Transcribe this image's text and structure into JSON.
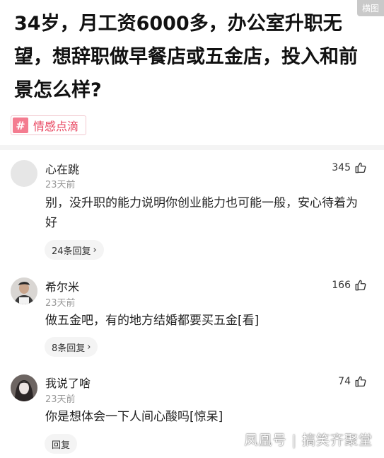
{
  "corner_badge": "横图",
  "article": {
    "title": "34岁，月工资6000多，办公室升职无望，想辞职做早餐店或五金店，投入和前景怎么样?"
  },
  "tag": {
    "icon": "#",
    "label": "情感点滴"
  },
  "comments": [
    {
      "username": "心在跳",
      "time": "23天前",
      "text": "别，没升职的能力说明你创业能力也可能一般，安心待着为好",
      "likes": "345",
      "reply_label": "24条回复",
      "avatar": "gray-placeholder-avatar"
    },
    {
      "username": "希尔米",
      "time": "23天前",
      "text": "做五金吧，有的地方结婚都要买五金[看]",
      "likes": "166",
      "reply_label": "8条回复",
      "avatar": "person-photo-avatar"
    },
    {
      "username": "我说了啥",
      "time": "23天前",
      "text": "你是想体会一下人间心酸吗[惊呆]",
      "likes": "74",
      "reply_label": "回复",
      "avatar": "woman-portrait-avatar"
    }
  ],
  "watermark": "凤凰号 | 搞笑齐聚堂",
  "colors": {
    "tag_accent": "#e8455f",
    "tag_icon_bg": "#f47c90",
    "muted_text": "#999999",
    "pill_bg": "#f4f4f4"
  }
}
